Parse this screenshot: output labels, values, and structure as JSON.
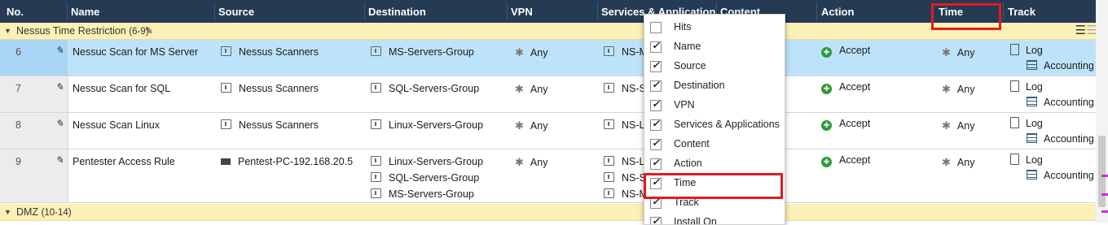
{
  "header": {
    "columns": [
      "No.",
      "Name",
      "Source",
      "Destination",
      "VPN",
      "Services & Applications",
      "Content",
      "Action",
      "Time",
      "Track"
    ]
  },
  "sections": [
    {
      "name": "Nessus Time Restriction",
      "range": "(6-9)"
    },
    {
      "name": "DMZ",
      "range": "(10-14)"
    }
  ],
  "rules": [
    {
      "no": "6",
      "name": "Nessuc Scan for MS Server",
      "source": [
        "Nessus Scanners"
      ],
      "destination": [
        "MS-Servers-Group"
      ],
      "vpn": "Any",
      "services": [
        "NS-MS"
      ],
      "action": "Accept",
      "time": "Any",
      "track": [
        "Log",
        "Accounting"
      ],
      "selected": true
    },
    {
      "no": "7",
      "name": "Nessuc Scan for SQL",
      "source": [
        "Nessus Scanners"
      ],
      "destination": [
        "SQL-Servers-Group"
      ],
      "vpn": "Any",
      "services": [
        "NS-SQL"
      ],
      "action": "Accept",
      "time": "Any",
      "track": [
        "Log",
        "Accounting"
      ],
      "selected": false
    },
    {
      "no": "8",
      "name": "Nessuc Scan Linux",
      "source": [
        "Nessus Scanners"
      ],
      "destination": [
        "Linux-Servers-Group"
      ],
      "vpn": "Any",
      "services": [
        "NS-Linux"
      ],
      "action": "Accept",
      "time": "Any",
      "track": [
        "Log",
        "Accounting"
      ],
      "selected": false
    },
    {
      "no": "9",
      "name": "Pentester Access Rule",
      "source": [
        "Pentest-PC-192.168.20.5"
      ],
      "destination": [
        "Linux-Servers-Group",
        "SQL-Servers-Group",
        "MS-Servers-Group"
      ],
      "vpn": "Any",
      "services": [
        "NS-Linux",
        "NS-SQL",
        "NS-MS"
      ],
      "action": "Accept",
      "time": "Any",
      "track": [
        "Log",
        "Accounting"
      ],
      "selected": false
    }
  ],
  "column_menu": {
    "items": [
      {
        "label": "Hits",
        "checked": false
      },
      {
        "label": "Name",
        "checked": true
      },
      {
        "label": "Source",
        "checked": true
      },
      {
        "label": "Destination",
        "checked": true
      },
      {
        "label": "VPN",
        "checked": true
      },
      {
        "label": "Services & Applications",
        "checked": true
      },
      {
        "label": "Content",
        "checked": true
      },
      {
        "label": "Action",
        "checked": true
      },
      {
        "label": "Time",
        "checked": true
      },
      {
        "label": "Track",
        "checked": true
      },
      {
        "label": "Install On",
        "checked": true
      }
    ]
  },
  "colors": {
    "header_bg": "#253b53",
    "section_bg": "#fbf0b5",
    "selected_row": "#bde3fb",
    "highlight": "#e11b22",
    "accept": "#2e9a3a"
  },
  "icons": {
    "edit": "pencil-icon",
    "network_group": "network-group-icon",
    "any": "asterisk-icon",
    "accept": "accept-icon",
    "log": "log-icon",
    "accounting": "accounting-icon",
    "host": "computer-icon",
    "menu": "hamburger-menu-icon"
  }
}
